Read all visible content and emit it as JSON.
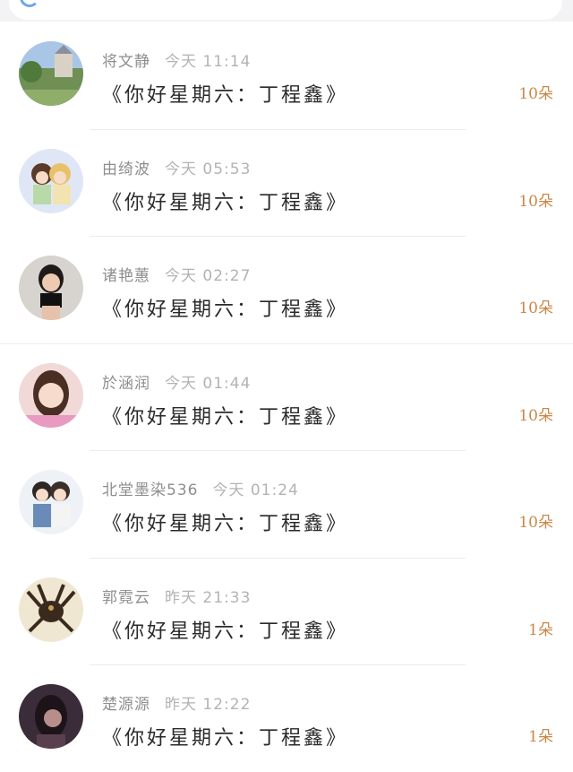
{
  "search": {
    "icon": "search-icon"
  },
  "colors": {
    "background": "#f3f3f5",
    "name_text": "#8e8e8e",
    "time_text": "#b3b3b3",
    "title_text": "#2a2a2a",
    "count_text": "#c98848"
  },
  "records": [
    {
      "name": "将文静",
      "time": "今天 11:14",
      "title": "《你好星期六：丁程鑫》",
      "count": "10朵"
    },
    {
      "name": "由绮波",
      "time": "今天 05:53",
      "title": "《你好星期六：丁程鑫》",
      "count": "10朵"
    },
    {
      "name": "诸艳蕙",
      "time": "今天 02:27",
      "title": "《你好星期六：丁程鑫》",
      "count": "10朵"
    },
    {
      "name": "於涵润",
      "time": "今天 01:44",
      "title": "《你好星期六：丁程鑫》",
      "count": "10朵"
    },
    {
      "name": "北堂墨染536",
      "time": "今天 01:24",
      "title": "《你好星期六：丁程鑫》",
      "count": "10朵"
    },
    {
      "name": "郭霓云",
      "time": "昨天 21:33",
      "title": "《你好星期六：丁程鑫》",
      "count": "1朵"
    },
    {
      "name": "楚源源",
      "time": "昨天 12:22",
      "title": "《你好星期六：丁程鑫》",
      "count": "1朵"
    }
  ]
}
